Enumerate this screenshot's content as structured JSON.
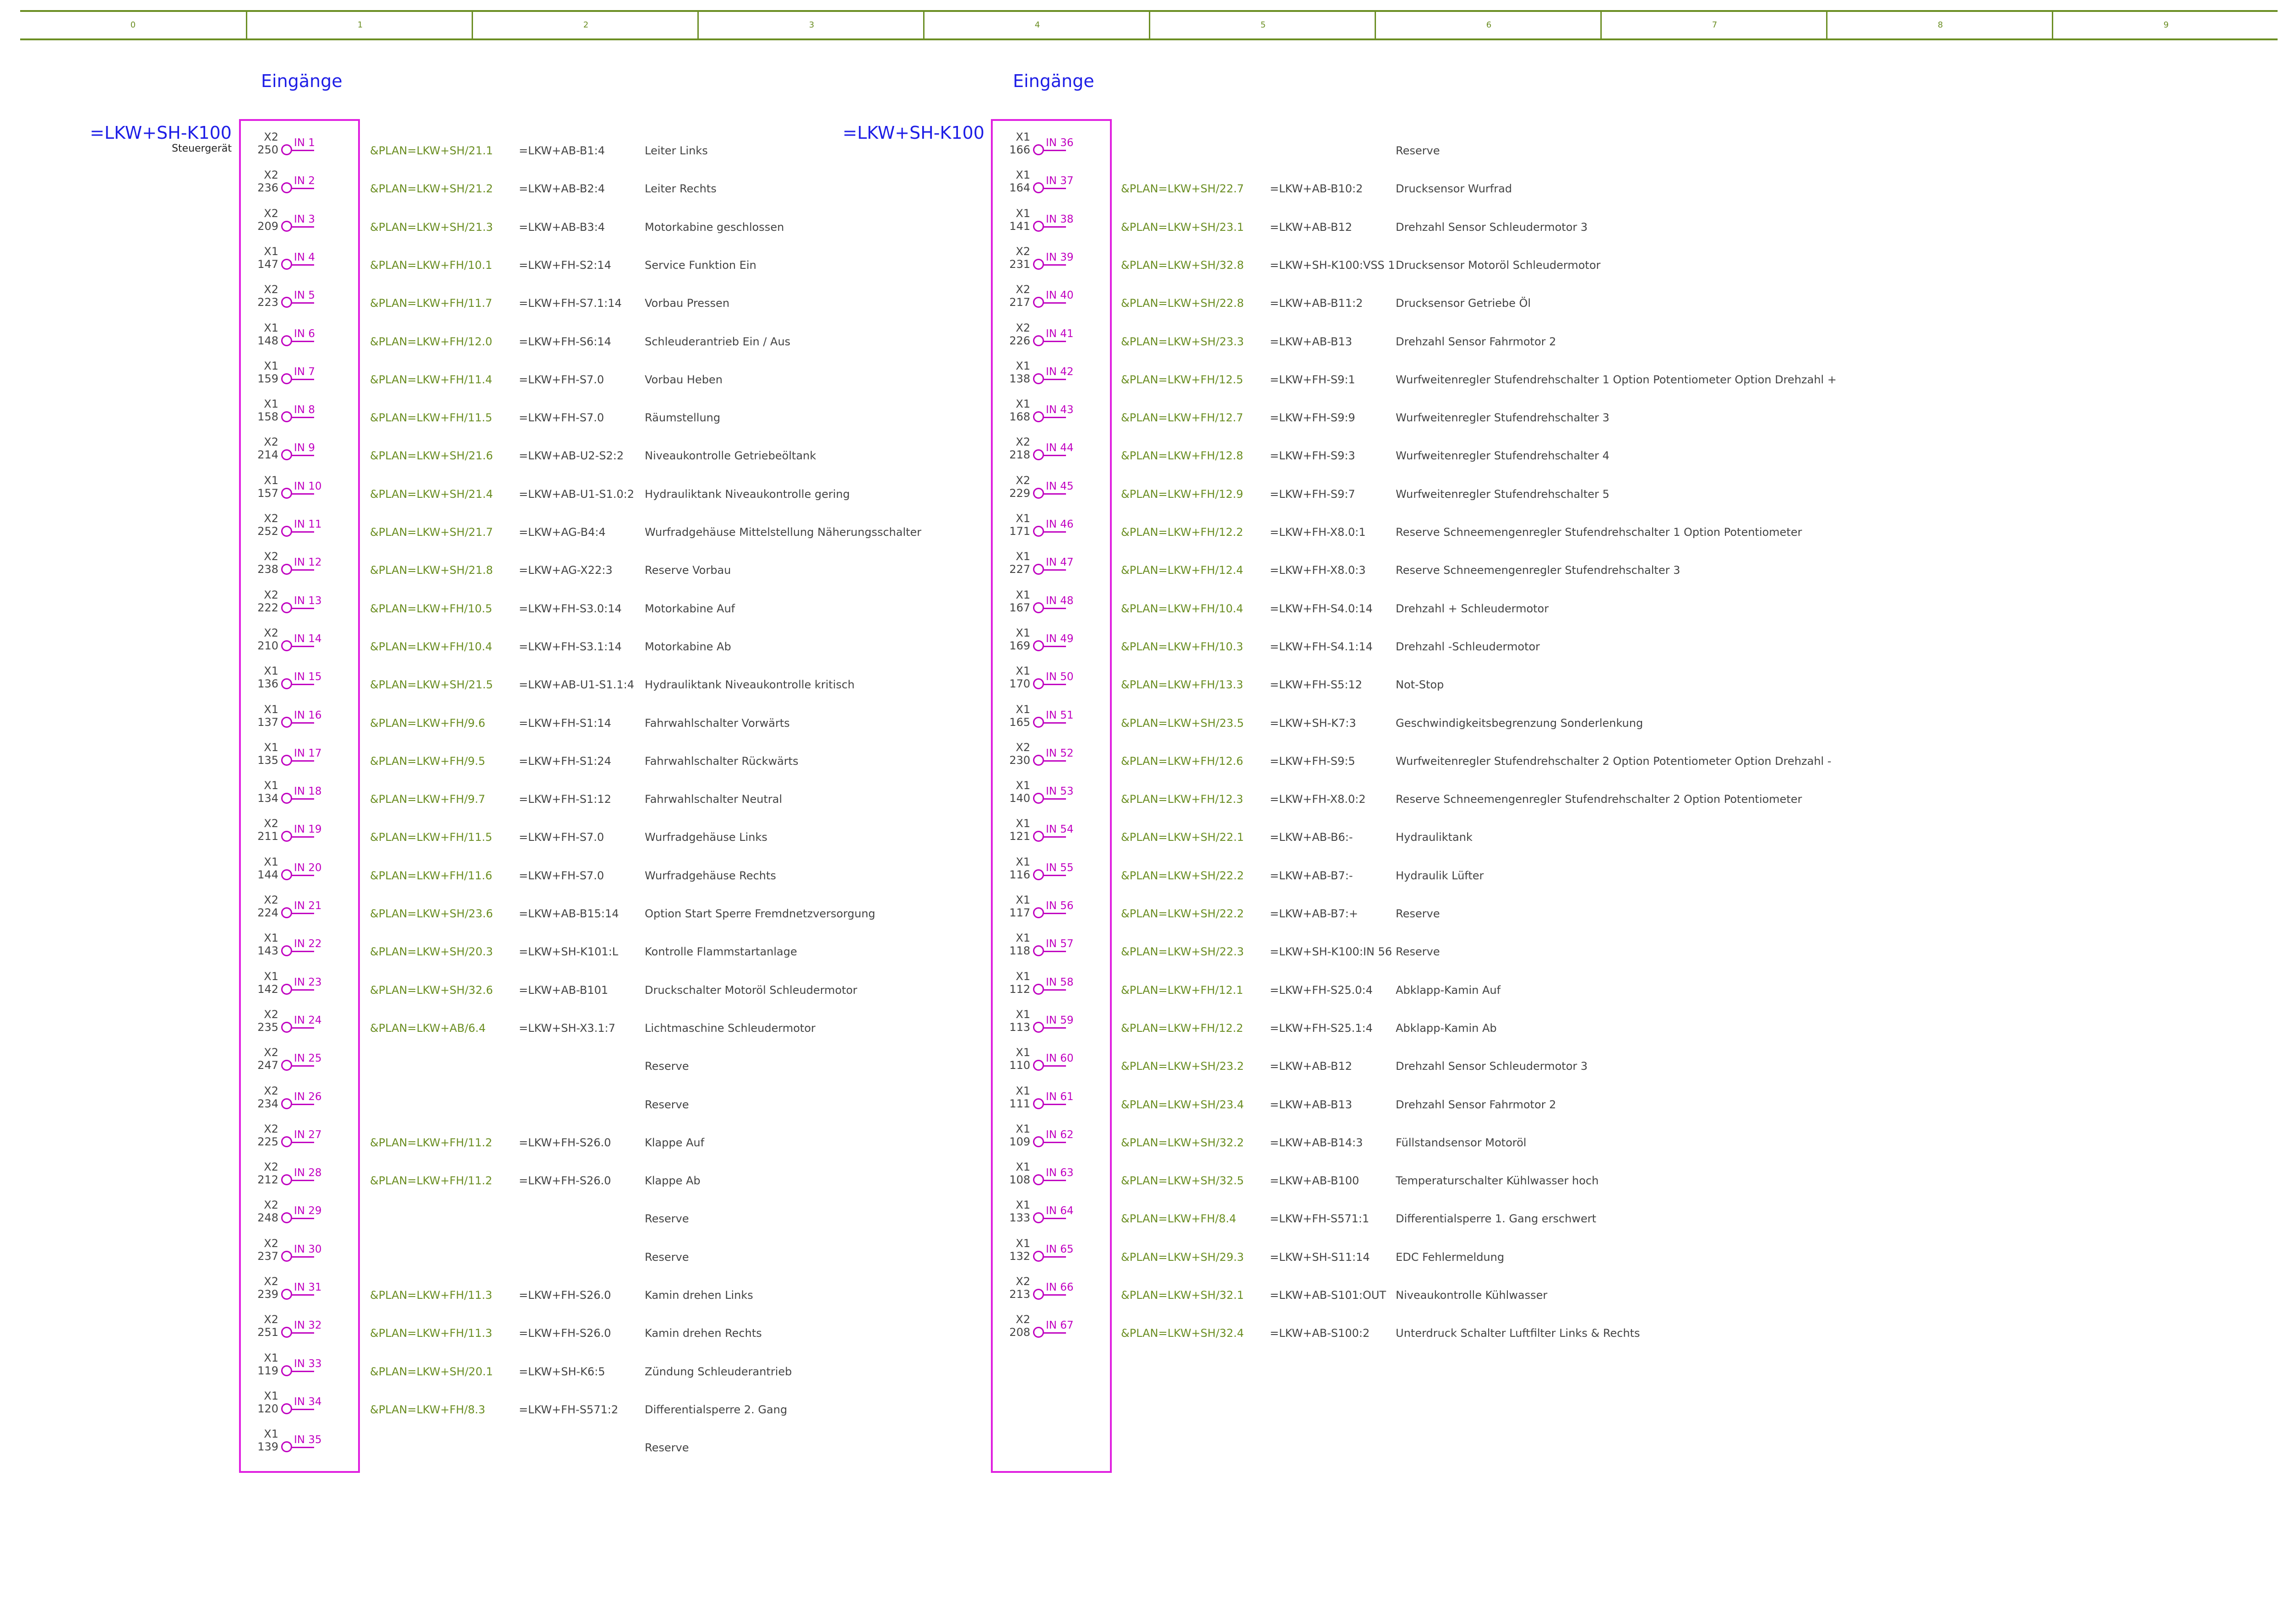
{
  "ruler": [
    "0",
    "1",
    "2",
    "3",
    "4",
    "5",
    "6",
    "7",
    "8",
    "9"
  ],
  "left": {
    "title": "Eingänge",
    "device": "=LKW+SH-K100",
    "device_sub": "Steuergerät",
    "rows": [
      {
        "x": "X2",
        "n": "250",
        "in": "IN 1",
        "ref": "&PLAN=LKW+SH/21.1",
        "tgt": "=LKW+AB-B1:4",
        "desc": "Leiter Links"
      },
      {
        "x": "X2",
        "n": "236",
        "in": "IN 2",
        "ref": "&PLAN=LKW+SH/21.2",
        "tgt": "=LKW+AB-B2:4",
        "desc": "Leiter Rechts"
      },
      {
        "x": "X2",
        "n": "209",
        "in": "IN 3",
        "ref": "&PLAN=LKW+SH/21.3",
        "tgt": "=LKW+AB-B3:4",
        "desc": "Motorkabine geschlossen"
      },
      {
        "x": "X1",
        "n": "147",
        "in": "IN 4",
        "ref": "&PLAN=LKW+FH/10.1",
        "tgt": "=LKW+FH-S2:14",
        "desc": "Service Funktion Ein"
      },
      {
        "x": "X2",
        "n": "223",
        "in": "IN 5",
        "ref": "&PLAN=LKW+FH/11.7",
        "tgt": "=LKW+FH-S7.1:14",
        "desc": "Vorbau Pressen"
      },
      {
        "x": "X1",
        "n": "148",
        "in": "IN 6",
        "ref": "&PLAN=LKW+FH/12.0",
        "tgt": "=LKW+FH-S6:14",
        "desc": "Schleuderantrieb Ein / Aus"
      },
      {
        "x": "X1",
        "n": "159",
        "in": "IN 7",
        "ref": "&PLAN=LKW+FH/11.4",
        "tgt": "=LKW+FH-S7.0",
        "desc": "Vorbau Heben"
      },
      {
        "x": "X1",
        "n": "158",
        "in": "IN 8",
        "ref": "&PLAN=LKW+FH/11.5",
        "tgt": "=LKW+FH-S7.0",
        "desc": "Räumstellung"
      },
      {
        "x": "X2",
        "n": "214",
        "in": "IN 9",
        "ref": "&PLAN=LKW+SH/21.6",
        "tgt": "=LKW+AB-U2-S2:2",
        "desc": "Niveaukontrolle Getriebeöltank"
      },
      {
        "x": "X1",
        "n": "157",
        "in": "IN 10",
        "ref": "&PLAN=LKW+SH/21.4",
        "tgt": "=LKW+AB-U1-S1.0:2",
        "desc": "Hydrauliktank Niveaukontrolle gering"
      },
      {
        "x": "X2",
        "n": "252",
        "in": "IN 11",
        "ref": "&PLAN=LKW+SH/21.7",
        "tgt": "=LKW+AG-B4:4",
        "desc": "Wurfradgehäuse Mittelstellung Näherungsschalter"
      },
      {
        "x": "X2",
        "n": "238",
        "in": "IN 12",
        "ref": "&PLAN=LKW+SH/21.8",
        "tgt": "=LKW+AG-X22:3",
        "desc": "Reserve Vorbau"
      },
      {
        "x": "X2",
        "n": "222",
        "in": "IN 13",
        "ref": "&PLAN=LKW+FH/10.5",
        "tgt": "=LKW+FH-S3.0:14",
        "desc": "Motorkabine Auf"
      },
      {
        "x": "X2",
        "n": "210",
        "in": "IN 14",
        "ref": "&PLAN=LKW+FH/10.4",
        "tgt": "=LKW+FH-S3.1:14",
        "desc": "Motorkabine Ab"
      },
      {
        "x": "X1",
        "n": "136",
        "in": "IN 15",
        "ref": "&PLAN=LKW+SH/21.5",
        "tgt": "=LKW+AB-U1-S1.1:4",
        "desc": "Hydrauliktank Niveaukontrolle kritisch"
      },
      {
        "x": "X1",
        "n": "137",
        "in": "IN 16",
        "ref": "&PLAN=LKW+FH/9.6",
        "tgt": "=LKW+FH-S1:14",
        "desc": "Fahrwahlschalter Vorwärts"
      },
      {
        "x": "X1",
        "n": "135",
        "in": "IN 17",
        "ref": "&PLAN=LKW+FH/9.5",
        "tgt": "=LKW+FH-S1:24",
        "desc": "Fahrwahlschalter Rückwärts"
      },
      {
        "x": "X1",
        "n": "134",
        "in": "IN 18",
        "ref": "&PLAN=LKW+FH/9.7",
        "tgt": "=LKW+FH-S1:12",
        "desc": "Fahrwahlschalter Neutral"
      },
      {
        "x": "X2",
        "n": "211",
        "in": "IN 19",
        "ref": "&PLAN=LKW+FH/11.5",
        "tgt": "=LKW+FH-S7.0",
        "desc": "Wurfradgehäuse Links"
      },
      {
        "x": "X1",
        "n": "144",
        "in": "IN 20",
        "ref": "&PLAN=LKW+FH/11.6",
        "tgt": "=LKW+FH-S7.0",
        "desc": "Wurfradgehäuse Rechts"
      },
      {
        "x": "X2",
        "n": "224",
        "in": "IN 21",
        "ref": "&PLAN=LKW+SH/23.6",
        "tgt": "=LKW+AB-B15:14",
        "desc": "Option Start Sperre Fremdnetzversorgung"
      },
      {
        "x": "X1",
        "n": "143",
        "in": "IN 22",
        "ref": "&PLAN=LKW+SH/20.3",
        "tgt": "=LKW+SH-K101:L",
        "desc": "Kontrolle Flammstartanlage"
      },
      {
        "x": "X1",
        "n": "142",
        "in": "IN 23",
        "ref": "&PLAN=LKW+SH/32.6",
        "tgt": "=LKW+AB-B101",
        "desc": "Druckschalter Motoröl Schleudermotor"
      },
      {
        "x": "X2",
        "n": "235",
        "in": "IN 24",
        "ref": "&PLAN=LKW+AB/6.4",
        "tgt": "=LKW+SH-X3.1:7",
        "desc": "Lichtmaschine Schleudermotor"
      },
      {
        "x": "X2",
        "n": "247",
        "in": "IN 25",
        "ref": "",
        "tgt": "",
        "desc": "Reserve"
      },
      {
        "x": "X2",
        "n": "234",
        "in": "IN 26",
        "ref": "",
        "tgt": "",
        "desc": "Reserve"
      },
      {
        "x": "X2",
        "n": "225",
        "in": "IN 27",
        "ref": "&PLAN=LKW+FH/11.2",
        "tgt": "=LKW+FH-S26.0",
        "desc": "Klappe Auf"
      },
      {
        "x": "X2",
        "n": "212",
        "in": "IN 28",
        "ref": "&PLAN=LKW+FH/11.2",
        "tgt": "=LKW+FH-S26.0",
        "desc": "Klappe Ab"
      },
      {
        "x": "X2",
        "n": "248",
        "in": "IN 29",
        "ref": "",
        "tgt": "",
        "desc": "Reserve"
      },
      {
        "x": "X2",
        "n": "237",
        "in": "IN 30",
        "ref": "",
        "tgt": "",
        "desc": "Reserve"
      },
      {
        "x": "X2",
        "n": "239",
        "in": "IN 31",
        "ref": "&PLAN=LKW+FH/11.3",
        "tgt": "=LKW+FH-S26.0",
        "desc": "Kamin drehen Links"
      },
      {
        "x": "X2",
        "n": "251",
        "in": "IN 32",
        "ref": "&PLAN=LKW+FH/11.3",
        "tgt": "=LKW+FH-S26.0",
        "desc": "Kamin drehen Rechts"
      },
      {
        "x": "X1",
        "n": "119",
        "in": "IN 33",
        "ref": "&PLAN=LKW+SH/20.1",
        "tgt": "=LKW+SH-K6:5",
        "desc": "Zündung Schleuderantrieb"
      },
      {
        "x": "X1",
        "n": "120",
        "in": "IN 34",
        "ref": "&PLAN=LKW+FH/8.3",
        "tgt": "=LKW+FH-S571:2",
        "desc": "Differentialsperre 2. Gang"
      },
      {
        "x": "X1",
        "n": "139",
        "in": "IN 35",
        "ref": "",
        "tgt": "",
        "desc": "Reserve"
      }
    ]
  },
  "right": {
    "title": "Eingänge",
    "device": "=LKW+SH-K100",
    "rows": [
      {
        "x": "X1",
        "n": "166",
        "in": "IN 36",
        "ref": "",
        "tgt": "",
        "desc": "Reserve"
      },
      {
        "x": "X1",
        "n": "164",
        "in": "IN 37",
        "ref": "&PLAN=LKW+SH/22.7",
        "tgt": "=LKW+AB-B10:2",
        "desc": "Drucksensor Wurfrad"
      },
      {
        "x": "X1",
        "n": "141",
        "in": "IN 38",
        "ref": "&PLAN=LKW+SH/23.1",
        "tgt": "=LKW+AB-B12",
        "desc": "Drehzahl Sensor Schleudermotor 3"
      },
      {
        "x": "X2",
        "n": "231",
        "in": "IN 39",
        "ref": "&PLAN=LKW+SH/32.8",
        "tgt": "=LKW+SH-K100:VSS 1",
        "desc": "Drucksensor Motoröl Schleudermotor"
      },
      {
        "x": "X2",
        "n": "217",
        "in": "IN 40",
        "ref": "&PLAN=LKW+SH/22.8",
        "tgt": "=LKW+AB-B11:2",
        "desc": "Drucksensor Getriebe Öl"
      },
      {
        "x": "X2",
        "n": "226",
        "in": "IN 41",
        "ref": "&PLAN=LKW+SH/23.3",
        "tgt": "=LKW+AB-B13",
        "desc": "Drehzahl Sensor Fahrmotor 2"
      },
      {
        "x": "X1",
        "n": "138",
        "in": "IN 42",
        "ref": "&PLAN=LKW+FH/12.5",
        "tgt": "=LKW+FH-S9:1",
        "desc": "Wurfweitenregler Stufendrehschalter 1 Option Potentiometer Option Drehzahl +"
      },
      {
        "x": "X1",
        "n": "168",
        "in": "IN 43",
        "ref": "&PLAN=LKW+FH/12.7",
        "tgt": "=LKW+FH-S9:9",
        "desc": "Wurfweitenregler Stufendrehschalter 3"
      },
      {
        "x": "X2",
        "n": "218",
        "in": "IN 44",
        "ref": "&PLAN=LKW+FH/12.8",
        "tgt": "=LKW+FH-S9:3",
        "desc": "Wurfweitenregler Stufendrehschalter 4"
      },
      {
        "x": "X2",
        "n": "229",
        "in": "IN 45",
        "ref": "&PLAN=LKW+FH/12.9",
        "tgt": "=LKW+FH-S9:7",
        "desc": "Wurfweitenregler Stufendrehschalter 5"
      },
      {
        "x": "X1",
        "n": "171",
        "in": "IN 46",
        "ref": "&PLAN=LKW+FH/12.2",
        "tgt": "=LKW+FH-X8.0:1",
        "desc": "Reserve Schneemengenregler Stufendrehschalter 1 Option Potentiometer"
      },
      {
        "x": "X1",
        "n": "227",
        "in": "IN 47",
        "ref": "&PLAN=LKW+FH/12.4",
        "tgt": "=LKW+FH-X8.0:3",
        "desc": "Reserve Schneemengenregler Stufendrehschalter 3"
      },
      {
        "x": "X1",
        "n": "167",
        "in": "IN 48",
        "ref": "&PLAN=LKW+FH/10.4",
        "tgt": "=LKW+FH-S4.0:14",
        "desc": "Drehzahl + Schleudermotor"
      },
      {
        "x": "X1",
        "n": "169",
        "in": "IN 49",
        "ref": "&PLAN=LKW+FH/10.3",
        "tgt": "=LKW+FH-S4.1:14",
        "desc": "Drehzahl -Schleudermotor"
      },
      {
        "x": "X1",
        "n": "170",
        "in": "IN 50",
        "ref": "&PLAN=LKW+FH/13.3",
        "tgt": "=LKW+FH-S5:12",
        "desc": "Not-Stop"
      },
      {
        "x": "X1",
        "n": "165",
        "in": "IN 51",
        "ref": "&PLAN=LKW+SH/23.5",
        "tgt": "=LKW+SH-K7:3",
        "desc": "Geschwindigkeitsbegrenzung Sonderlenkung"
      },
      {
        "x": "X2",
        "n": "230",
        "in": "IN 52",
        "ref": "&PLAN=LKW+FH/12.6",
        "tgt": "=LKW+FH-S9:5",
        "desc": "Wurfweitenregler Stufendrehschalter 2 Option Potentiometer Option Drehzahl -"
      },
      {
        "x": "X1",
        "n": "140",
        "in": "IN 53",
        "ref": "&PLAN=LKW+FH/12.3",
        "tgt": "=LKW+FH-X8.0:2",
        "desc": "Reserve Schneemengenregler Stufendrehschalter 2 Option Potentiometer"
      },
      {
        "x": "X1",
        "n": "121",
        "in": "IN 54",
        "ref": "&PLAN=LKW+SH/22.1",
        "tgt": "=LKW+AB-B6:-",
        "desc": "Hydrauliktank"
      },
      {
        "x": "X1",
        "n": "116",
        "in": "IN 55",
        "ref": "&PLAN=LKW+SH/22.2",
        "tgt": "=LKW+AB-B7:-",
        "desc": "Hydraulik Lüfter"
      },
      {
        "x": "X1",
        "n": "117",
        "in": "IN 56",
        "ref": "&PLAN=LKW+SH/22.2",
        "tgt": "=LKW+AB-B7:+",
        "desc": "Reserve"
      },
      {
        "x": "X1",
        "n": "118",
        "in": "IN 57",
        "ref": "&PLAN=LKW+SH/22.3",
        "tgt": "=LKW+SH-K100:IN 56",
        "desc": "Reserve"
      },
      {
        "x": "X1",
        "n": "112",
        "in": "IN 58",
        "ref": "&PLAN=LKW+FH/12.1",
        "tgt": "=LKW+FH-S25.0:4",
        "desc": "Abklapp-Kamin Auf"
      },
      {
        "x": "X1",
        "n": "113",
        "in": "IN 59",
        "ref": "&PLAN=LKW+FH/12.2",
        "tgt": "=LKW+FH-S25.1:4",
        "desc": "Abklapp-Kamin Ab"
      },
      {
        "x": "X1",
        "n": "110",
        "in": "IN 60",
        "ref": "&PLAN=LKW+SH/23.2",
        "tgt": "=LKW+AB-B12",
        "desc": "Drehzahl Sensor Schleudermotor 3"
      },
      {
        "x": "X1",
        "n": "111",
        "in": "IN 61",
        "ref": "&PLAN=LKW+SH/23.4",
        "tgt": "=LKW+AB-B13",
        "desc": "Drehzahl Sensor Fahrmotor 2"
      },
      {
        "x": "X1",
        "n": "109",
        "in": "IN 62",
        "ref": "&PLAN=LKW+SH/32.2",
        "tgt": "=LKW+AB-B14:3",
        "desc": "Füllstandsensor Motoröl"
      },
      {
        "x": "X1",
        "n": "108",
        "in": "IN 63",
        "ref": "&PLAN=LKW+SH/32.5",
        "tgt": "=LKW+AB-B100",
        "desc": "Temperaturschalter Kühlwasser hoch"
      },
      {
        "x": "X1",
        "n": "133",
        "in": "IN 64",
        "ref": "&PLAN=LKW+FH/8.4",
        "tgt": "=LKW+FH-S571:1",
        "desc": "Differentialsperre 1. Gang erschwert"
      },
      {
        "x": "X1",
        "n": "132",
        "in": "IN 65",
        "ref": "&PLAN=LKW+SH/29.3",
        "tgt": "=LKW+SH-S11:14",
        "desc": "EDC Fehlermeldung"
      },
      {
        "x": "X2",
        "n": "213",
        "in": "IN 66",
        "ref": "&PLAN=LKW+SH/32.1",
        "tgt": "=LKW+AB-S101:OUT",
        "desc": "Niveaukontrolle Kühlwasser"
      },
      {
        "x": "X2",
        "n": "208",
        "in": "IN 67",
        "ref": "&PLAN=LKW+SH/32.4",
        "tgt": "=LKW+AB-S100:2",
        "desc": "Unterdruck Schalter Luftfilter Links & Rechts"
      }
    ]
  }
}
